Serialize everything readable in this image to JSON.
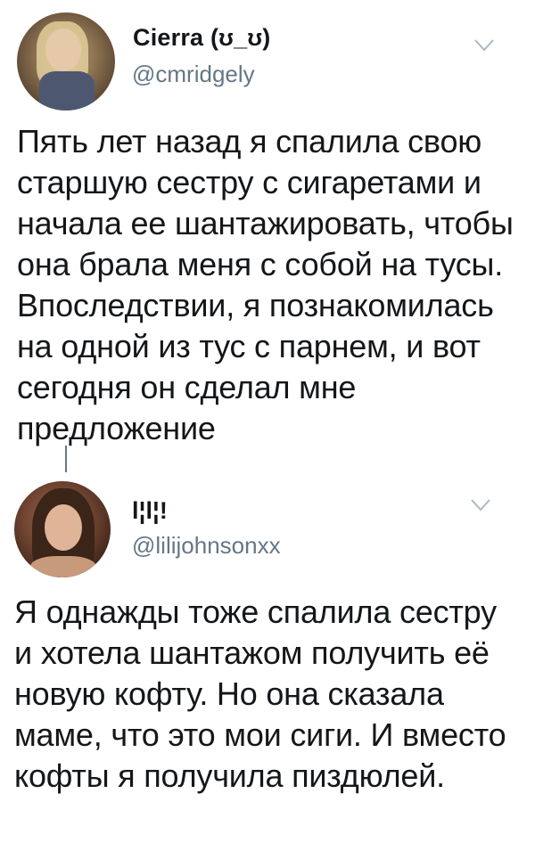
{
  "tweets": [
    {
      "display_name": "Сіerra (ʊ_ʊ)",
      "handle": "@cmridgely",
      "avatar_icon": "user-avatar-photo",
      "menu_icon": "chevron-down-icon",
      "text": "Пять лет назад я спалила свою старшую сестру с сигаретами и начала ее шантажировать, чтобы она брала меня с собой на тусы. Впоследствии, я познакомилась на одной из тус с парнем, и вот сегодня он сделал мне предложение"
    },
    {
      "display_name": "l¦l¦!",
      "handle": "@lilijohnsonxx",
      "avatar_icon": "user-avatar-photo",
      "menu_icon": "chevron-down-icon",
      "text": "Я однажды тоже спалила сестру и хотела шантажом получить её новую кофту. Но она сказала маме, что это мои сиги. И вместо кофты я получила пиздюлей."
    }
  ],
  "colors": {
    "text": "#14171a",
    "secondary": "#657786",
    "chevron": "#aab8c2",
    "background": "#ffffff"
  }
}
